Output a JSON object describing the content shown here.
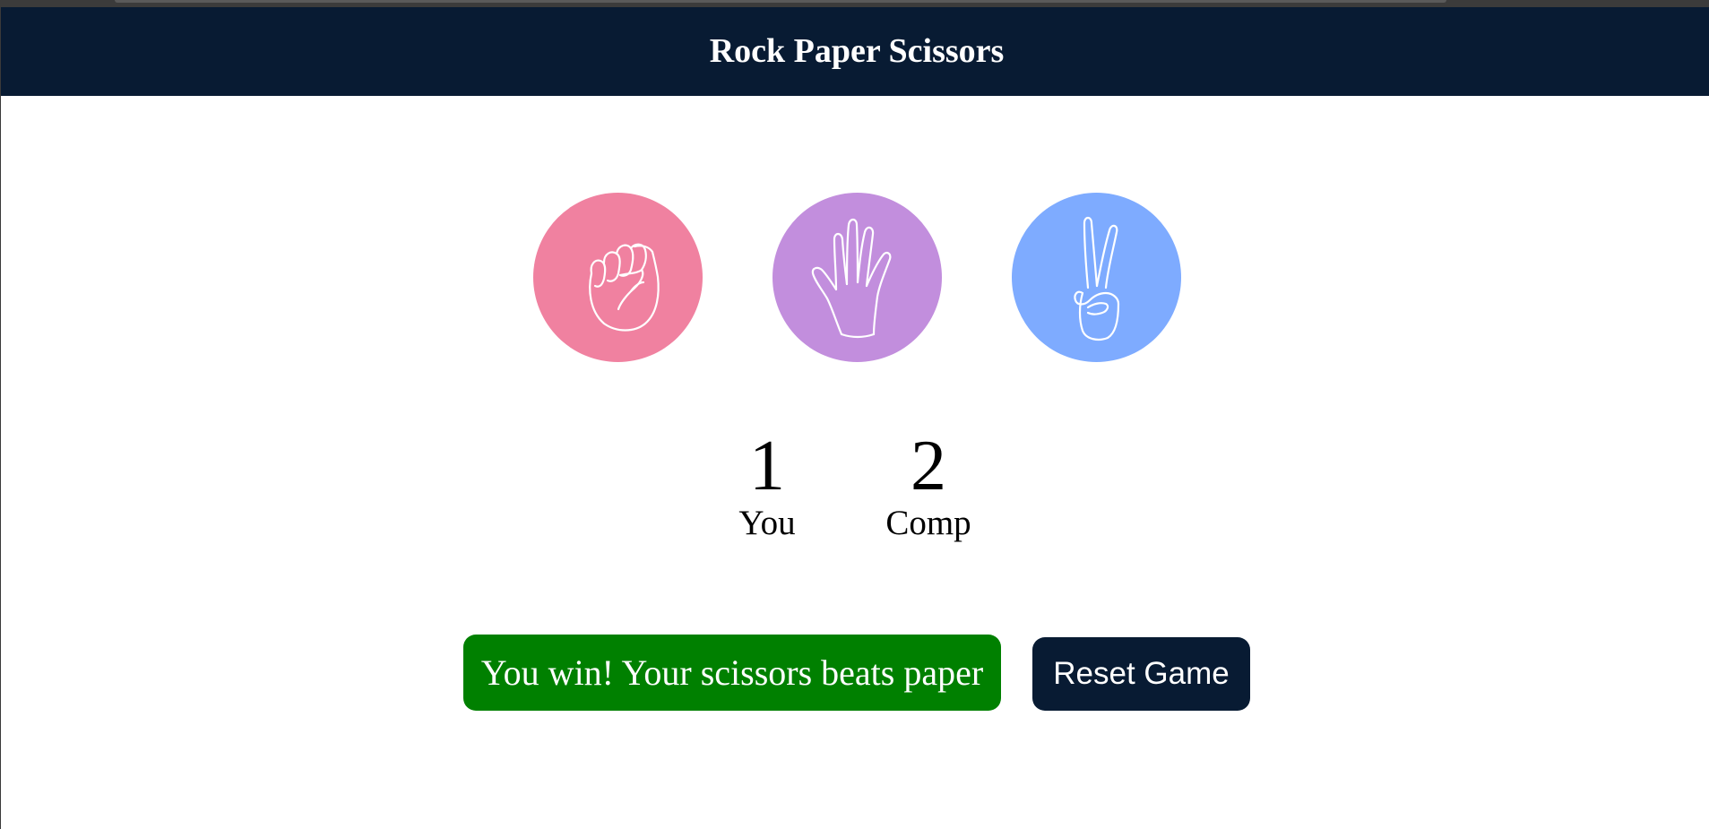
{
  "header": {
    "title": "Rock Paper Scissors"
  },
  "choices": [
    {
      "name": "rock",
      "icon": "fist-icon",
      "color": "#f081a0"
    },
    {
      "name": "paper",
      "icon": "open-hand-icon",
      "color": "#c28edd"
    },
    {
      "name": "scissors",
      "icon": "peace-sign-icon",
      "color": "#7eabff"
    }
  ],
  "score": {
    "user_score": "1",
    "user_label": "You",
    "comp_score": "2",
    "comp_label": "Comp"
  },
  "result": {
    "message": "You win! Your scissors beats paper",
    "color": "#008000"
  },
  "controls": {
    "reset_label": "Reset Game"
  },
  "theme": {
    "navbar_color": "#081b33"
  }
}
